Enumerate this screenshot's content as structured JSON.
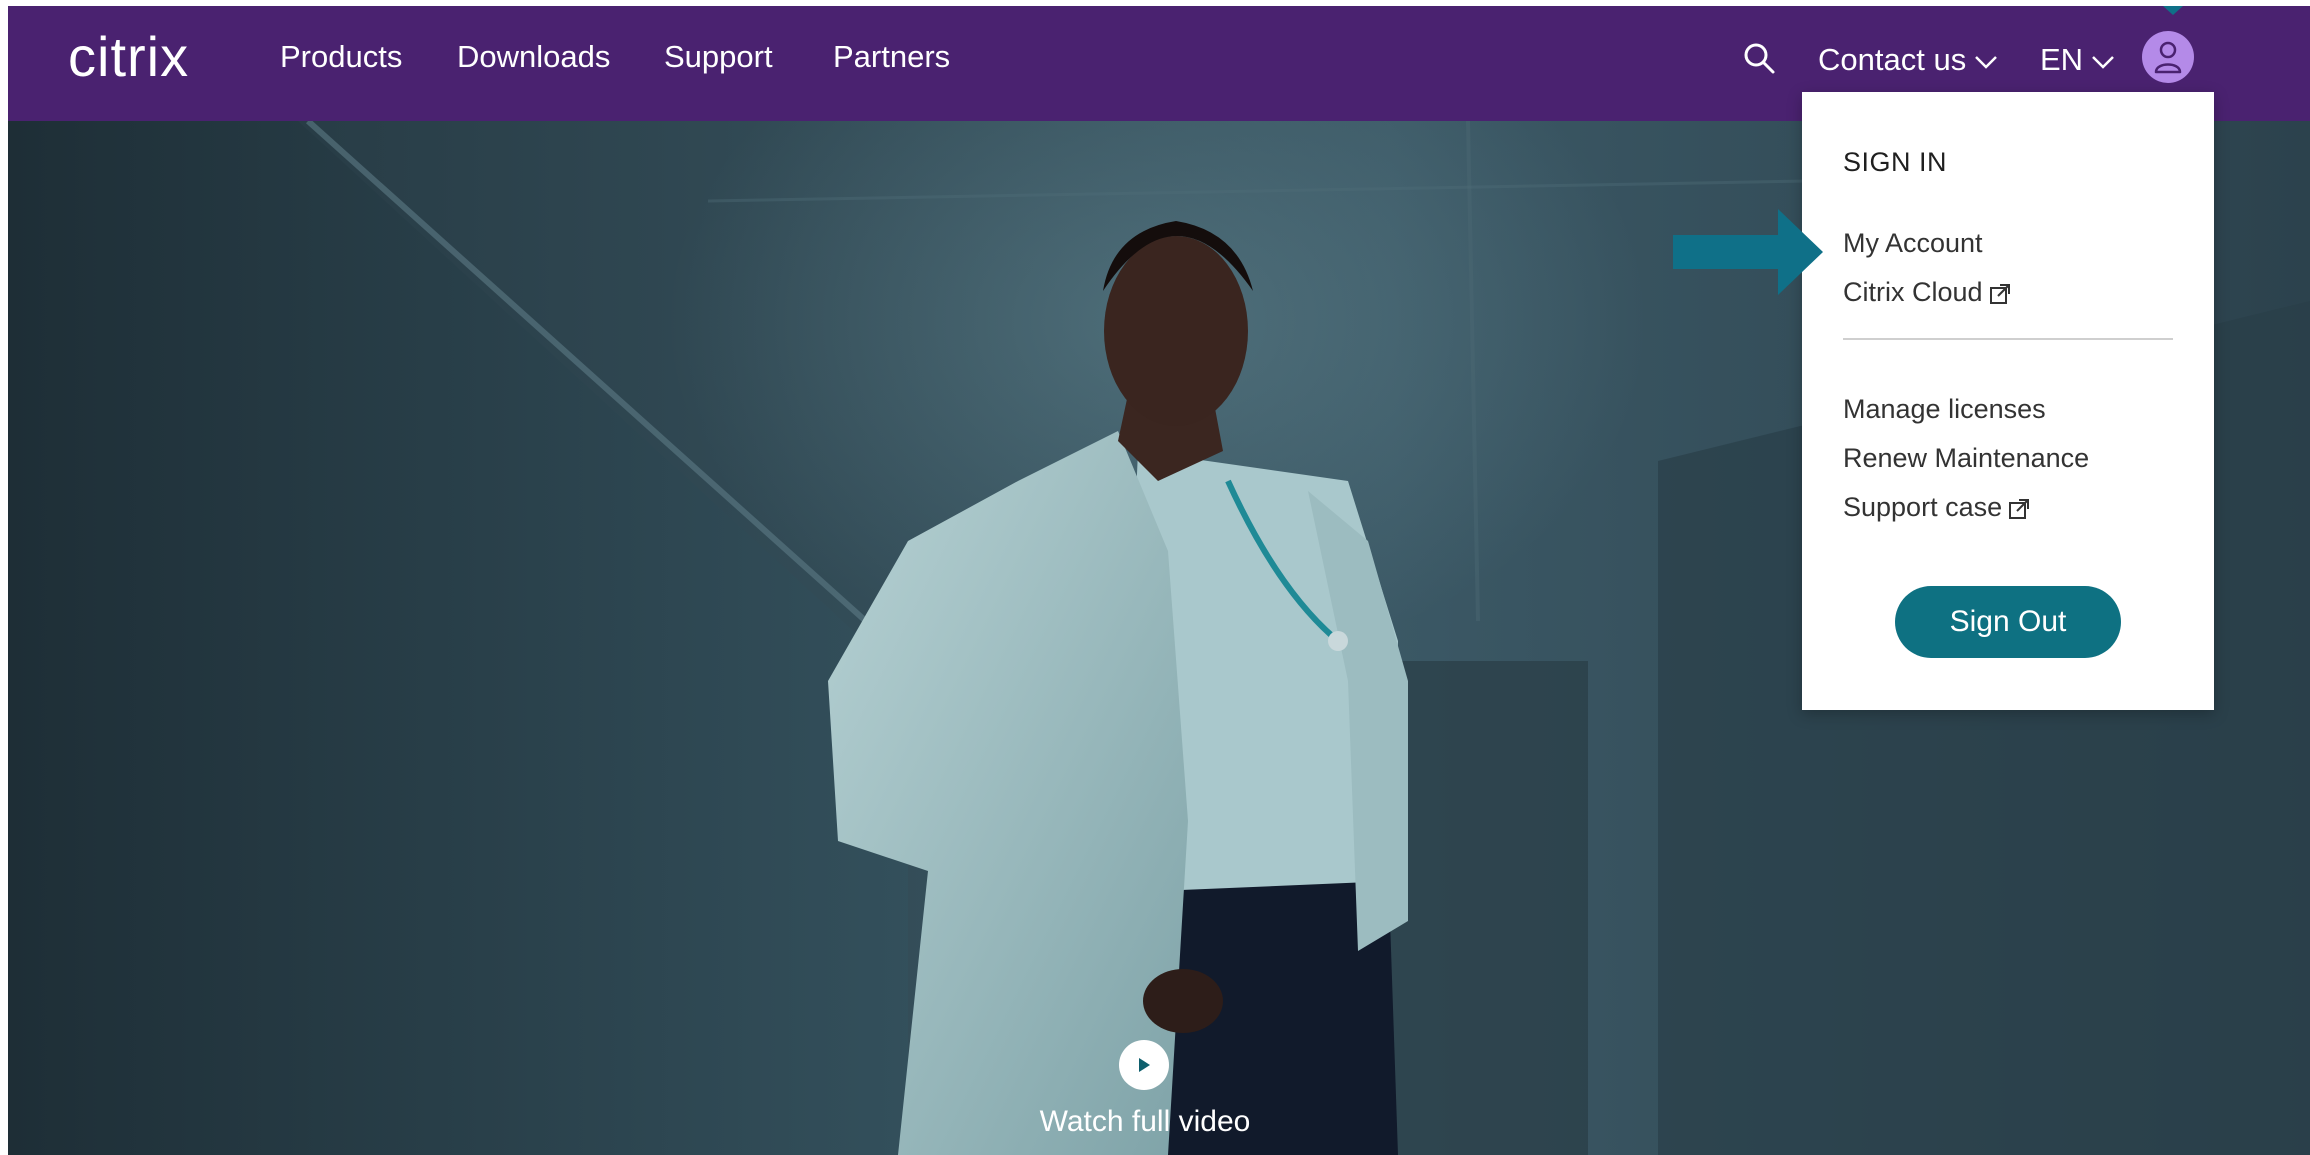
{
  "header": {
    "logo": "citrix",
    "nav": [
      "Products",
      "Downloads",
      "Support",
      "Partners"
    ],
    "contact_label": "Contact us",
    "language_label": "EN",
    "colors": {
      "bar": "#4a2270",
      "avatar": "#b48ae8"
    }
  },
  "account_menu": {
    "heading": "SIGN IN",
    "links_primary": [
      {
        "label": "My Account",
        "external": false
      },
      {
        "label": "Citrix Cloud",
        "external": true
      }
    ],
    "links_secondary": [
      {
        "label": "Manage licenses",
        "external": false
      },
      {
        "label": "Renew Maintenance",
        "external": false
      },
      {
        "label": "Support case",
        "external": true
      }
    ],
    "sign_out_label": "Sign Out",
    "colors": {
      "button": "#0e7182"
    }
  },
  "hero": {
    "video_label": "Watch full video"
  },
  "annotation": {
    "arrow_color": "#0f7088"
  }
}
